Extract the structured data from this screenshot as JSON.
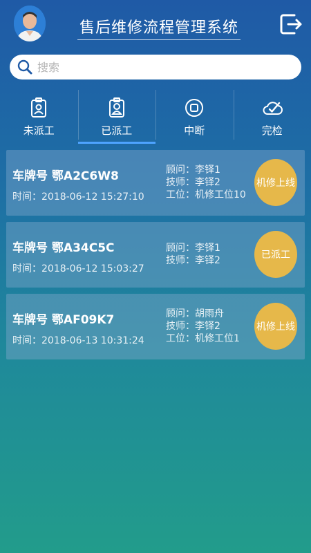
{
  "header": {
    "title": "售后维修流程管理系统",
    "logout_icon": "logout-icon",
    "avatar_icon": "user-avatar"
  },
  "search": {
    "placeholder": "搜索",
    "value": "",
    "icon": "search-icon"
  },
  "tabs": [
    {
      "label": "未派工",
      "icon": "badge-icon",
      "active": false
    },
    {
      "label": "已派工",
      "icon": "badge-person-icon",
      "active": true
    },
    {
      "label": "中断",
      "icon": "pause-circle-icon",
      "active": false
    },
    {
      "label": "完检",
      "icon": "cloud-check-icon",
      "active": false
    }
  ],
  "orders": [
    {
      "plate_label": "车牌号",
      "plate": "鄂A2C6W8",
      "time_label": "时间：",
      "time": "2018-06-12 15:27:10",
      "advisor_label": "顾问：",
      "advisor": "李铎1",
      "tech_label": "技师：",
      "tech": "李铎2",
      "station_label": "工位：",
      "station": "机修工位10",
      "status": "机修上线"
    },
    {
      "plate_label": "车牌号",
      "plate": "鄂A34C5C",
      "time_label": "时间：",
      "time": "2018-06-12 15:03:27",
      "advisor_label": "顾问：",
      "advisor": "李铎1",
      "tech_label": "技师：",
      "tech": "李铎2",
      "status": "已派工"
    },
    {
      "plate_label": "车牌号",
      "plate": "鄂AF09K7",
      "time_label": "时间：",
      "time": "2018-06-13 10:31:24",
      "advisor_label": "顾问：",
      "advisor": "胡雨舟",
      "tech_label": "技师：",
      "tech": "李铎2",
      "station_label": "工位：",
      "station": "机修工位1",
      "status": "机修上线"
    }
  ],
  "colors": {
    "accent": "#4ea3ff",
    "status_badge": "#e6b84a",
    "background_top": "#1f5aa6",
    "background_bottom": "#229c8b"
  }
}
